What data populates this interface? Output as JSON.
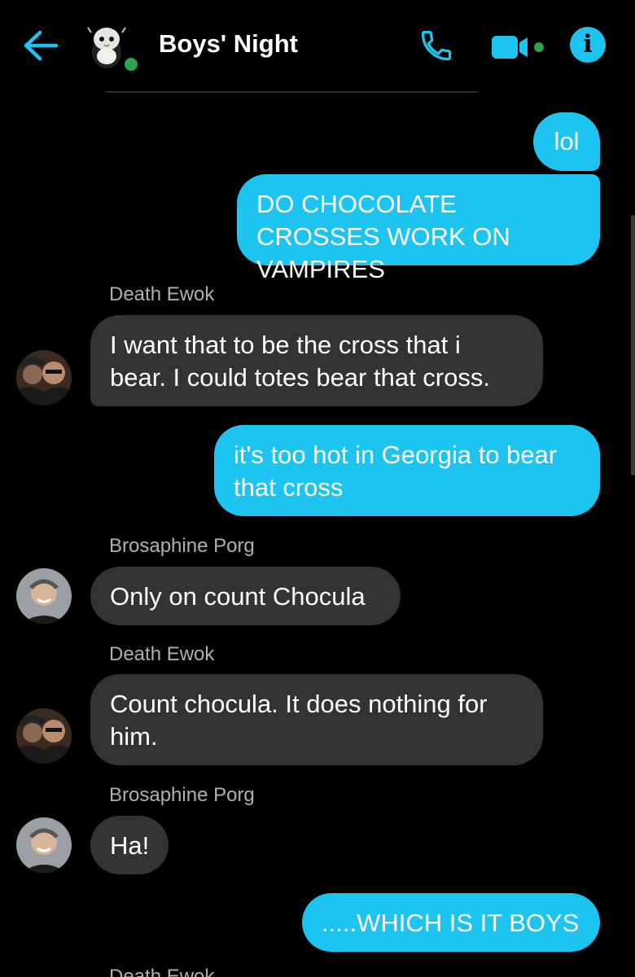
{
  "header": {
    "title": "Boys' Night",
    "accent_color": "#1dc4f0",
    "icons": [
      "back-arrow-icon",
      "group-avatar",
      "phone-icon",
      "video-camera-icon",
      "info-icon"
    ]
  },
  "messages": [
    {
      "text": "lol",
      "direction": "outgoing"
    },
    {
      "text": "DO CHOCOLATE CROSSES WORK ON VAMPIRES",
      "direction": "outgoing"
    },
    {
      "sender": "Death Ewok",
      "text": "I want that to be the cross that i bear. I could totes bear that cross.",
      "direction": "incoming"
    },
    {
      "text": "it's too hot in Georgia to bear that cross",
      "direction": "outgoing"
    },
    {
      "sender": "Brosaphine Porg",
      "text": "Only on count Chocula",
      "direction": "incoming"
    },
    {
      "sender": "Death Ewok",
      "text": "Count chocula. It does nothing for him.",
      "direction": "incoming"
    },
    {
      "sender": "Brosaphine Porg",
      "text": "Ha!",
      "direction": "incoming"
    },
    {
      "text": ".....WHICH IS IT BOYS",
      "direction": "outgoing"
    }
  ],
  "partial_sender": "Death Ewok"
}
